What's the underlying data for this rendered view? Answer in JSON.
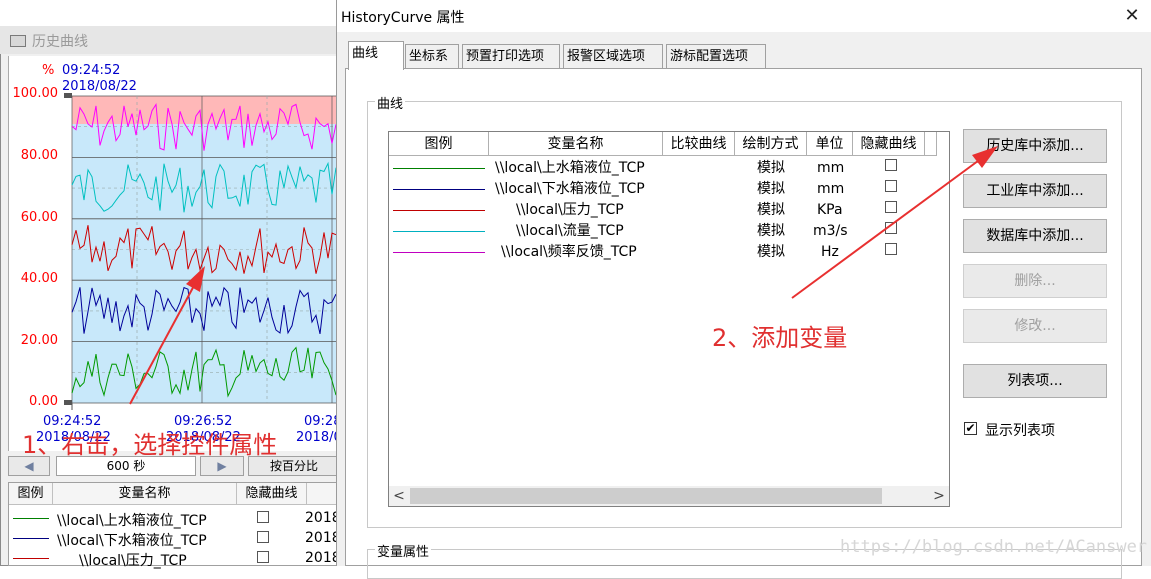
{
  "bg_window": {
    "title": "历史曲线",
    "y_unit": "%",
    "start_time": "09:24:52",
    "start_date": "2018/08/22",
    "y_ticks": [
      "100.00",
      "80.00",
      "60.00",
      "40.00",
      "20.00",
      "0.00"
    ],
    "x_labels": [
      {
        "time": "09:24:52",
        "date": "2018/08/22"
      },
      {
        "time": "09:26:52",
        "date": "2018/08/22"
      },
      {
        "time": "09:28",
        "date": "2018/0"
      }
    ],
    "scroll_left": "◀",
    "span_value": "600 秒",
    "scroll_right": "▶",
    "percent_button": "按百分比",
    "table_headers": [
      "图例",
      "变量名称",
      "隐藏曲线"
    ],
    "rows": [
      {
        "name": "\\\\local\\上水箱液位_TCP",
        "date": "2018",
        "color": "#008000"
      },
      {
        "name": "\\\\local\\下水箱液位_TCP",
        "date": "2018",
        "color": "#000080"
      },
      {
        "name": "\\\\local\\压力_TCP",
        "date": "2018",
        "color": "#c00000"
      }
    ],
    "series_colors": {
      "pink": "#ff00ff",
      "cyan": "#00c0c0",
      "red": "#cc0000",
      "blue": "#000099",
      "green": "#009900"
    }
  },
  "dialog": {
    "title": "HistoryCurve 属性",
    "close": "✕",
    "tabs": [
      "曲线",
      "坐标系",
      "预置打印选项",
      "报警区域选项",
      "游标配置选项"
    ],
    "group_curve": "曲线",
    "group_var": "变量属性",
    "list_headers": [
      "图例",
      "变量名称",
      "比较曲线",
      "绘制方式",
      "单位",
      "隐藏曲线"
    ],
    "list_rows": [
      {
        "name": "\\\\local\\上水箱液位_TCP",
        "mode": "模拟",
        "unit": "mm",
        "color": "#008000"
      },
      {
        "name": "\\\\local\\下水箱液位_TCP",
        "mode": "模拟",
        "unit": "mm",
        "color": "#000080"
      },
      {
        "name": "\\\\local\\压力_TCP",
        "mode": "模拟",
        "unit": "KPa",
        "color": "#c00000"
      },
      {
        "name": "\\\\local\\流量_TCP",
        "mode": "模拟",
        "unit": "m3/s",
        "color": "#00b0c0"
      },
      {
        "name": "\\\\local\\频率反馈_TCP",
        "mode": "模拟",
        "unit": "Hz",
        "color": "#c000c0"
      }
    ],
    "scroll_left": "<",
    "scroll_right": ">",
    "buttons": {
      "add_history": "历史库中添加...",
      "add_industry": "工业库中添加...",
      "add_database": "数据库中添加...",
      "delete": "删除...",
      "modify": "修改...",
      "list_items": "列表项..."
    },
    "show_list_check": "✔",
    "show_list_label": "显示列表项"
  },
  "annotations": {
    "step1": "1、右击，选择控件属性",
    "step2": "2、添加变量",
    "color": "#e03030"
  },
  "watermark": "https://blog.csdn.net/ACanswer"
}
